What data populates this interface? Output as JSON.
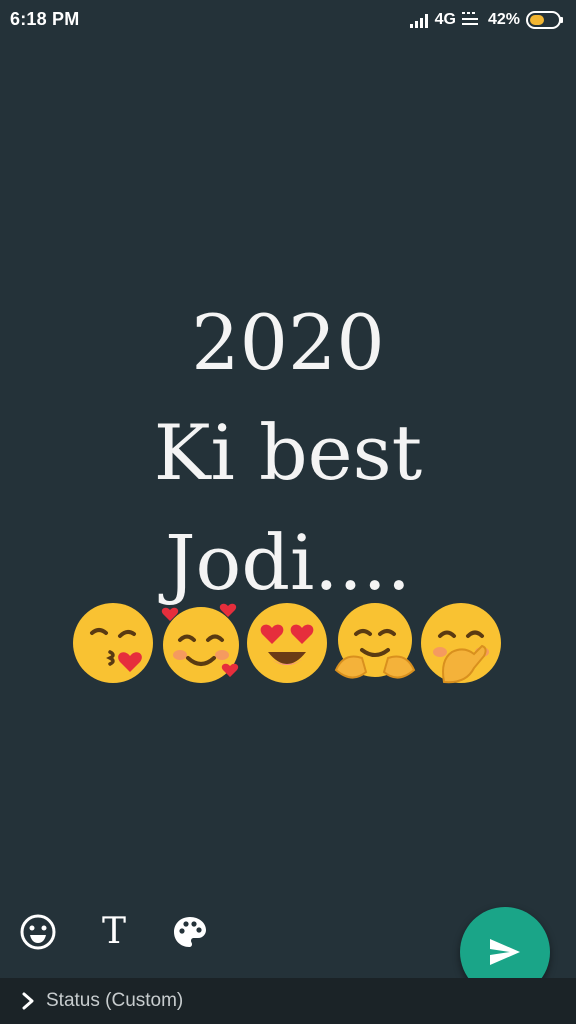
{
  "status_bar": {
    "time": "6:18 PM",
    "network": "4G",
    "battery": "42%",
    "icons": [
      "signal-icon",
      "volte-icon",
      "battery-icon"
    ]
  },
  "status": {
    "lines": [
      "2020",
      "Ki best",
      "Jodi...."
    ],
    "emojis": [
      "face-blowing-kiss-icon",
      "smiling-face-with-hearts-icon",
      "heart-eyes-icon",
      "hugging-face-icon",
      "face-with-hand-over-mouth-icon"
    ]
  },
  "tools": {
    "emoji": "emoji-icon",
    "text": "T",
    "color": "palette-icon"
  },
  "send": {
    "icon": "send-icon",
    "color": "#1aa588"
  },
  "audience": {
    "label": "Status (Custom)"
  },
  "colors": {
    "background": "#243239",
    "bottom_bar": "#1b2327",
    "accent": "#1aa588"
  }
}
